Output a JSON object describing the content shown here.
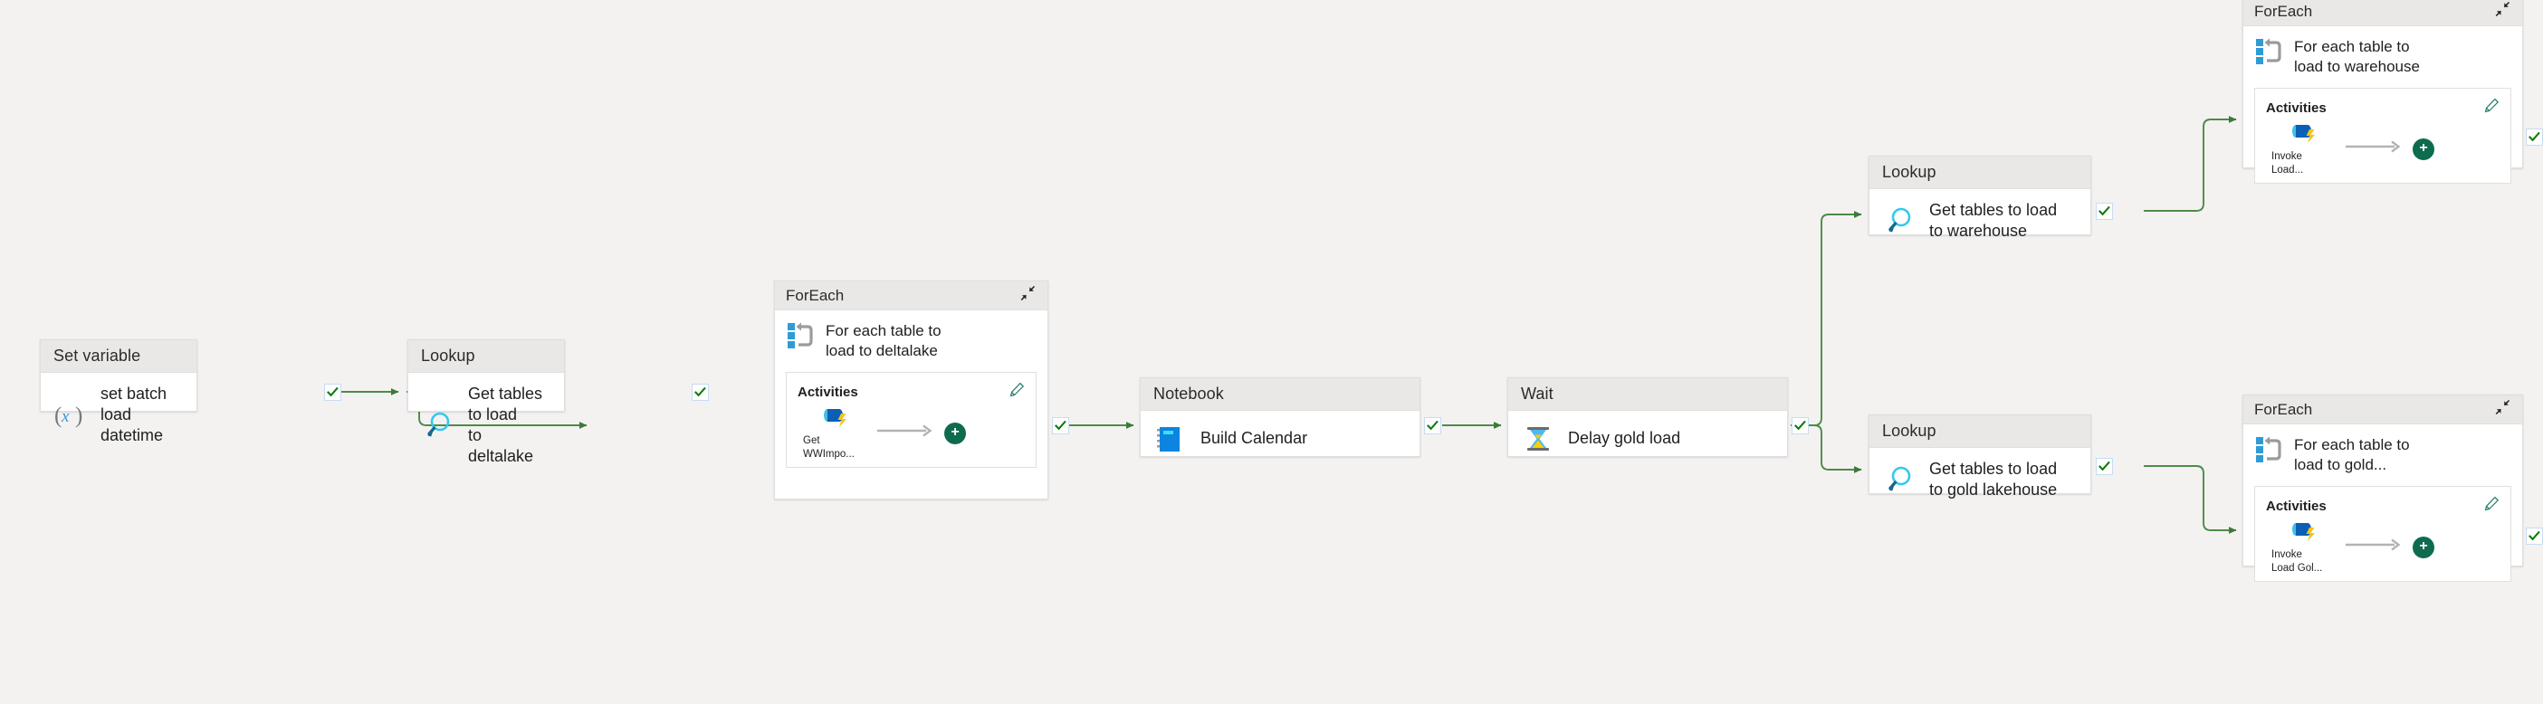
{
  "canvas": {
    "background": "#f3f2f1",
    "edge_color": "#4e8a4a",
    "header_bg": "#e9e8e7",
    "accent_green": "#0f6b4f",
    "check_color": "#107c10"
  },
  "nodes": [
    {
      "id": "set-variable",
      "type_label": "Set variable",
      "name": "set batch load\ndatetime",
      "icon": "variable-x-icon"
    },
    {
      "id": "lookup-deltalake",
      "type_label": "Lookup",
      "name": "Get tables to load\nto deltalake",
      "icon": "magnifier-icon"
    },
    {
      "id": "notebook-build-calendar",
      "type_label": "Notebook",
      "name": "Build Calendar",
      "icon": "notebook-icon"
    },
    {
      "id": "wait-delay-gold",
      "type_label": "Wait",
      "name": "Delay gold load",
      "icon": "hourglass-icon"
    },
    {
      "id": "lookup-warehouse",
      "type_label": "Lookup",
      "name": "Get tables to load\nto warehouse",
      "icon": "magnifier-icon"
    },
    {
      "id": "lookup-gold-lakehouse",
      "type_label": "Lookup",
      "name": "Get tables to load\nto gold lakehouse",
      "icon": "magnifier-icon"
    }
  ],
  "foreach_containers": [
    {
      "id": "foreach-deltalake",
      "type_label": "ForEach",
      "name": "For each table to\nload to deltalake",
      "expand_icon": "collapse-diagonal-icon",
      "activities": {
        "title": "Activities",
        "edit_icon": "pencil-icon",
        "add_icon": "plus-icon",
        "items": [
          {
            "name": "Get\nWWImpo...",
            "icon": "invoke-pipeline-icon"
          }
        ]
      }
    },
    {
      "id": "foreach-warehouse",
      "type_label": "ForEach",
      "name": "For each table to\nload to warehouse",
      "expand_icon": "collapse-diagonal-icon",
      "activities": {
        "title": "Activities",
        "edit_icon": "pencil-icon",
        "add_icon": "plus-icon",
        "items": [
          {
            "name": "Invoke\nLoad...",
            "icon": "invoke-pipeline-icon"
          }
        ]
      }
    },
    {
      "id": "foreach-gold",
      "type_label": "ForEach",
      "name": "For each table to\nload to gold...",
      "expand_icon": "collapse-diagonal-icon",
      "activities": {
        "title": "Activities",
        "edit_icon": "pencil-icon",
        "add_icon": "plus-icon",
        "items": [
          {
            "name": "Invoke\nLoad Gol...",
            "icon": "invoke-pipeline-icon"
          }
        ]
      }
    }
  ],
  "connections": [
    {
      "from": "set-variable",
      "to": "lookup-deltalake",
      "status": "success"
    },
    {
      "from": "lookup-deltalake",
      "to": "foreach-deltalake",
      "status": "success"
    },
    {
      "from": "foreach-deltalake",
      "to": "notebook-build-calendar",
      "status": "success"
    },
    {
      "from": "notebook-build-calendar",
      "to": "wait-delay-gold",
      "status": "success"
    },
    {
      "from": "wait-delay-gold",
      "to": "lookup-warehouse",
      "status": "success"
    },
    {
      "from": "wait-delay-gold",
      "to": "lookup-gold-lakehouse",
      "status": "success"
    },
    {
      "from": "lookup-warehouse",
      "to": "foreach-warehouse",
      "status": "success"
    },
    {
      "from": "lookup-gold-lakehouse",
      "to": "foreach-gold",
      "status": "success"
    },
    {
      "from": "foreach-warehouse",
      "to": "end-top",
      "status": "success"
    },
    {
      "from": "foreach-gold",
      "to": "end-bottom",
      "status": "success"
    }
  ]
}
